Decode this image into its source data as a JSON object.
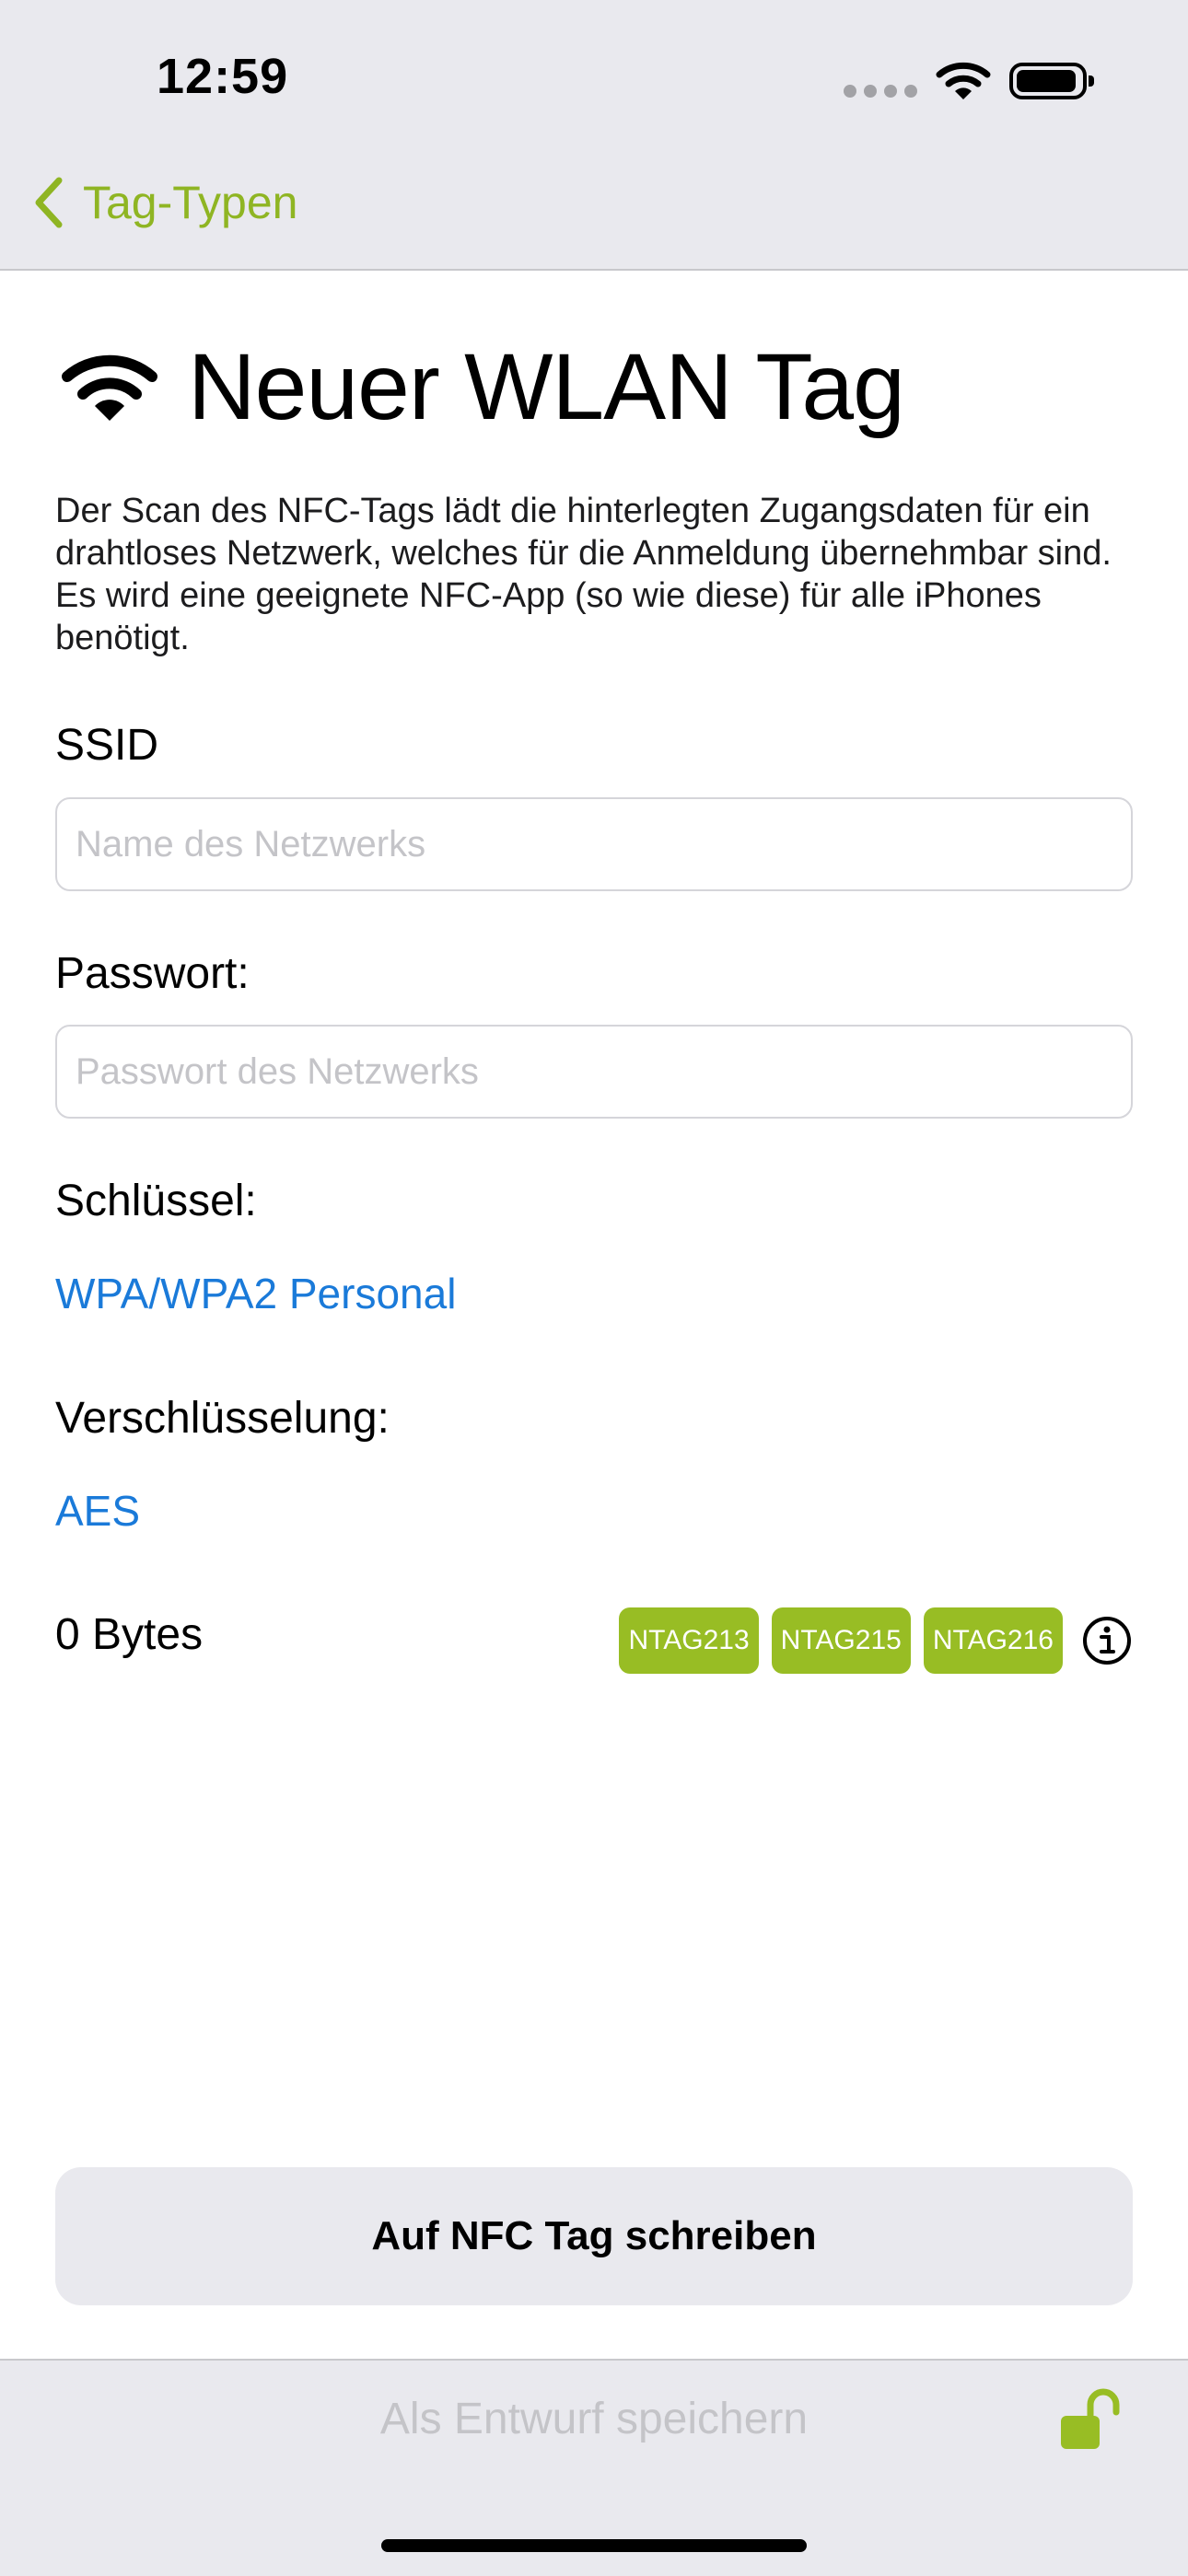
{
  "status_bar": {
    "time": "12:59"
  },
  "nav": {
    "back_label": "Tag-Typen"
  },
  "page": {
    "title": "Neuer WLAN Tag",
    "description": "Der Scan des NFC-Tags lädt die hinterlegten Zugangsdaten für ein drahtloses Netzwerk, welches für die Anmeldung übernehmbar sind. Es wird eine geeignete NFC-App (so wie diese) für alle iPhones benötigt."
  },
  "form": {
    "ssid_label": "SSID",
    "ssid_placeholder": "Name des Netzwerks",
    "password_label": "Passwort:",
    "password_placeholder": "Passwort des Netzwerks",
    "key_label": "Schlüssel:",
    "key_value": "WPA/WPA2 Personal",
    "encryption_label": "Verschlüsselung:",
    "encryption_value": "AES"
  },
  "size": {
    "bytes": "0 Bytes",
    "badges": [
      "NTAG213",
      "NTAG215",
      "NTAG216"
    ]
  },
  "actions": {
    "write_button": "Auf NFC Tag schreiben",
    "draft_button": "Als Entwurf speichern"
  },
  "colors": {
    "accent_green": "#98bd24",
    "link_blue": "#1a7ad9",
    "bar_background": "#e9e9ee"
  },
  "icons": [
    "wifi-icon",
    "battery-icon",
    "chevron-left-icon",
    "info-icon",
    "unlocked-lock-icon"
  ]
}
